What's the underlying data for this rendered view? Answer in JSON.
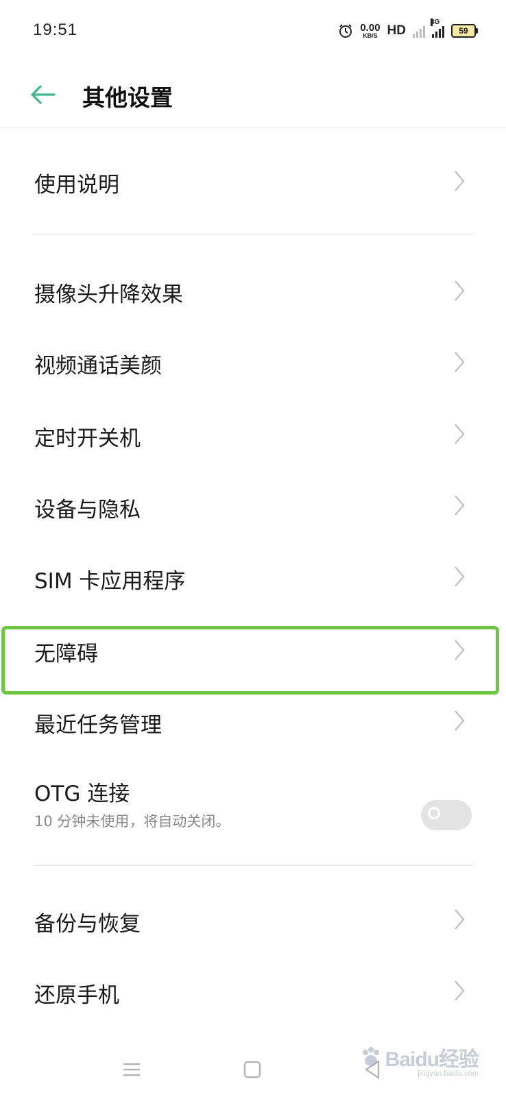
{
  "status_bar": {
    "time": "19:51",
    "net_speed_value": "0.00",
    "net_speed_unit": "KB/S",
    "hd_label": "HD",
    "network_type": "4G",
    "battery_level": "59"
  },
  "header": {
    "title": "其他设置",
    "accent_color": "#3dba8c"
  },
  "menu": {
    "usage_guide": "使用说明",
    "camera_lift_effect": "摄像头升降效果",
    "video_call_beauty": "视频通话美颜",
    "scheduled_power": "定时开关机",
    "device_privacy": "设备与隐私",
    "sim_apps": "SIM 卡应用程序",
    "accessibility": "无障碍",
    "recent_tasks": "最近任务管理",
    "otg_title": "OTG 连接",
    "otg_subtitle": "10 分钟未使用，将自动关闭。",
    "otg_enabled": false,
    "backup_restore": "备份与恢复",
    "reset_phone": "还原手机"
  },
  "highlight_color": "#6cc644",
  "watermark": {
    "text": "Baidu经验",
    "sub": "jingyan.baidu.com"
  }
}
